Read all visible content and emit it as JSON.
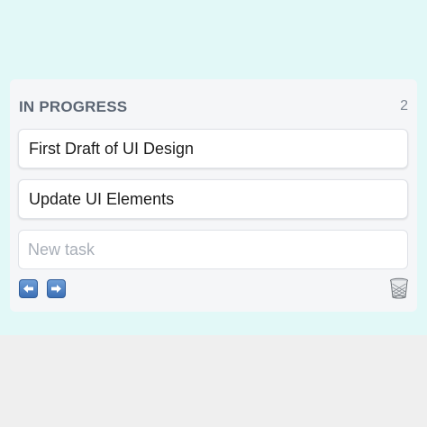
{
  "column": {
    "title": "IN PROGRESS",
    "count": "2",
    "cards": [
      {
        "text": "First Draft of UI Design"
      },
      {
        "text": "Update UI Elements"
      }
    ],
    "new_task_placeholder": "New task"
  },
  "icons": {
    "move_left": "left-arrow-icon",
    "move_right": "right-arrow-icon",
    "delete": "trash-icon"
  },
  "colors": {
    "top_background": "#e2f8f7",
    "bottom_background": "#efefef",
    "column_background": "#f5f6f8",
    "arrow_button": "#3b6fb5"
  }
}
